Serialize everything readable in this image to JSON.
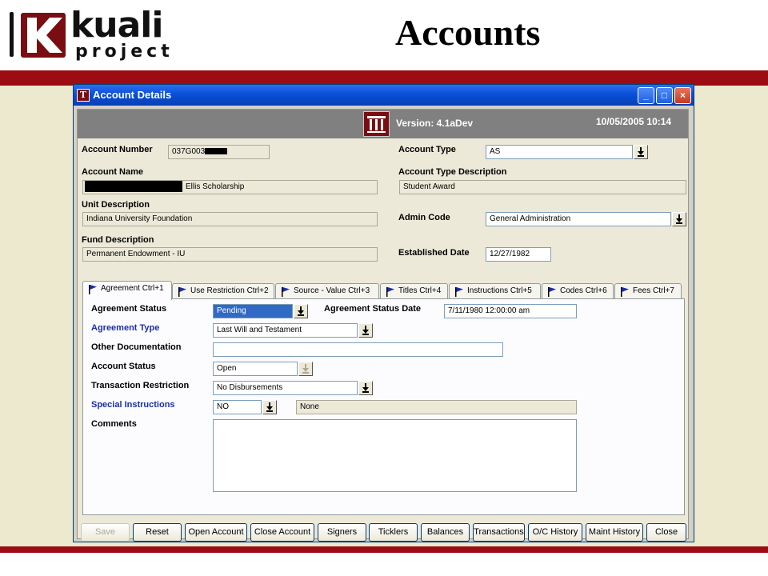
{
  "slide": {
    "logo_line1": "kuali",
    "logo_line2": "project",
    "title": "Accounts"
  },
  "window": {
    "title": "Account Details",
    "controls": [
      "_",
      "□",
      "×"
    ]
  },
  "header": {
    "version": "Version: 4.1aDev",
    "datetime": "10/05/2005 10:14"
  },
  "account": {
    "number_label": "Account Number",
    "number_value": "037G003",
    "name_label": "Account Name",
    "name_value": "Ellis Scholarship",
    "unit_label": "Unit Description",
    "unit_value": "Indiana University Foundation",
    "fund_label": "Fund Description",
    "fund_value": "Permanent Endowment - IU",
    "type_label": "Account Type",
    "type_value": "AS",
    "type_desc_label": "Account Type Description",
    "type_desc_value": "Student Award",
    "admin_label": "Admin Code",
    "admin_value": "General Administration",
    "established_label": "Established Date",
    "established_value": "12/27/1982"
  },
  "tabs": [
    {
      "label": "Agreement Ctrl+1",
      "active": true
    },
    {
      "label": "Use Restriction Ctrl+2"
    },
    {
      "label": "Source - Value Ctrl+3"
    },
    {
      "label": "Titles Ctrl+4"
    },
    {
      "label": "Instructions Ctrl+5"
    },
    {
      "label": "Codes Ctrl+6"
    },
    {
      "label": "Fees Ctrl+7"
    }
  ],
  "agreement": {
    "status_label": "Agreement Status",
    "status_value": "Pending",
    "status_date_label": "Agreement Status Date",
    "status_date_value": "7/11/1980 12:00:00 am",
    "type_label": "Agreement Type",
    "type_value": "Last Will and Testament",
    "other_doc_label": "Other Documentation",
    "other_doc_value": "",
    "account_status_label": "Account Status",
    "account_status_value": "Open",
    "txn_restriction_label": "Transaction Restriction",
    "txn_restriction_value": "No Disbursements",
    "special_label": "Special Instructions",
    "special_code": "NO",
    "special_desc": "None",
    "comments_label": "Comments",
    "comments_value": ""
  },
  "buttons": [
    {
      "label": "Save",
      "enabled": false
    },
    {
      "label": "Reset"
    },
    {
      "label": "Open Account"
    },
    {
      "label": "Close Account"
    },
    {
      "label": "Signers"
    },
    {
      "label": "Ticklers"
    },
    {
      "label": "Balances"
    },
    {
      "label": "Transactions"
    },
    {
      "label": "O/C History"
    },
    {
      "label": "Maint History"
    },
    {
      "label": "Close"
    }
  ],
  "colors": {
    "brand_red": "#9c0c12",
    "cream": "#ece9cf",
    "title_bar": "#0a4fd8",
    "required_label_blue": "#1c2fa8",
    "selection": "#316ac5"
  }
}
